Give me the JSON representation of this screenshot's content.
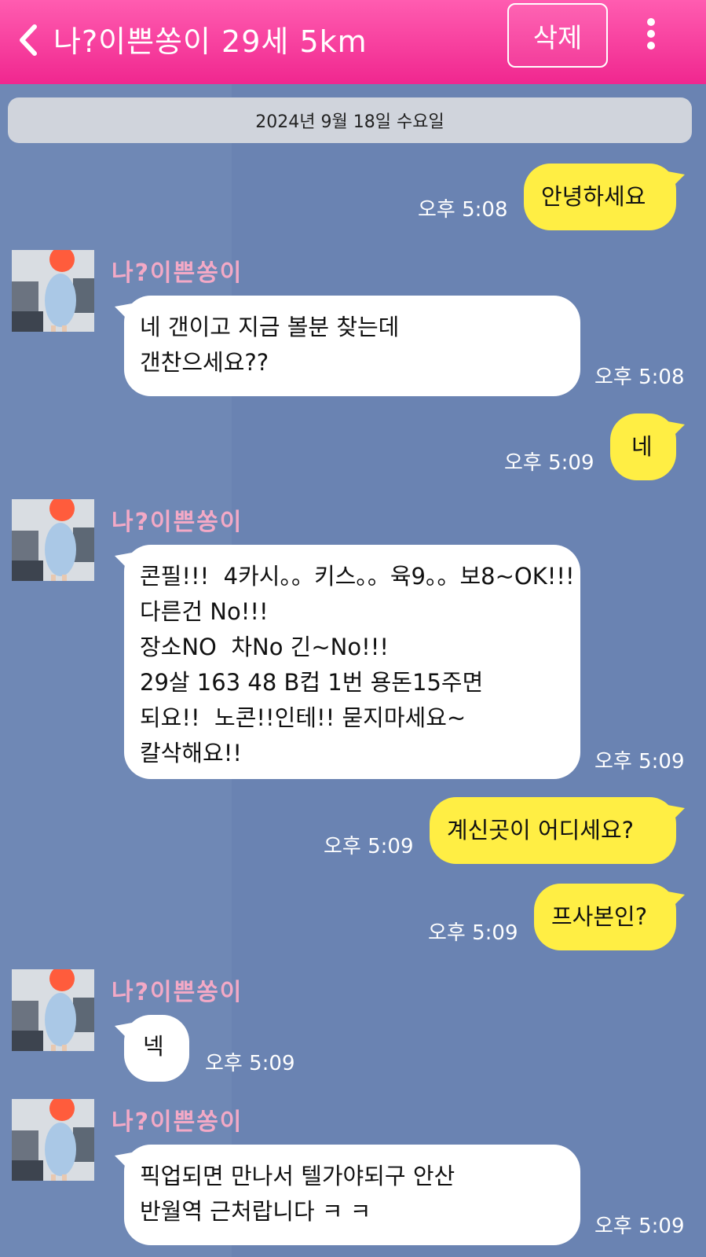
{
  "header": {
    "title": "나?이쁜쏭이 29세 5km",
    "delete_label": "삭제",
    "bg_color": "#f8399c"
  },
  "date_divider": "2024년 9월 18일 수요일",
  "sender_name": "나?이쁜쏭이",
  "messages": [
    {
      "dir": "out",
      "text": "안녕하세요",
      "time": "오후 5:08"
    },
    {
      "dir": "in",
      "text": "네 갠이고 지금 볼분 찾는데\n갠찬으세요??",
      "time": "오후 5:08"
    },
    {
      "dir": "out",
      "text": "네",
      "time": "오후 5:09"
    },
    {
      "dir": "in",
      "text": "콘필!!!  4카시。。키스。。육9。。보8~OK!!!\n다른건 No!!!\n장소NO  차No 긴~No!!!\n29살 163 48 B컵 1번 용돈15주면\n되요!!  노콘!!인테!! 묻지마세요~\n칼삭해요!!",
      "time": "오후 5:09"
    },
    {
      "dir": "out",
      "text": "계신곳이 어디세요?",
      "time": "오후 5:09"
    },
    {
      "dir": "out",
      "text": "프사본인?",
      "time": "오후 5:09"
    },
    {
      "dir": "in",
      "text": "넥",
      "time": "오후 5:09"
    },
    {
      "dir": "in",
      "text": "픽업되면 만나서 텔가야되구 안산\n반월역 근처랍니다 ㅋ ㅋ",
      "time": "오후 5:09"
    }
  ],
  "colors": {
    "background": "#6f88b6",
    "outgoing_bubble": "#ffee44",
    "incoming_bubble": "#ffffff",
    "sender_name": "#f3a9c6"
  },
  "icons": [
    "back-chevron-icon",
    "more-vertical-icon",
    "avatar-image"
  ]
}
